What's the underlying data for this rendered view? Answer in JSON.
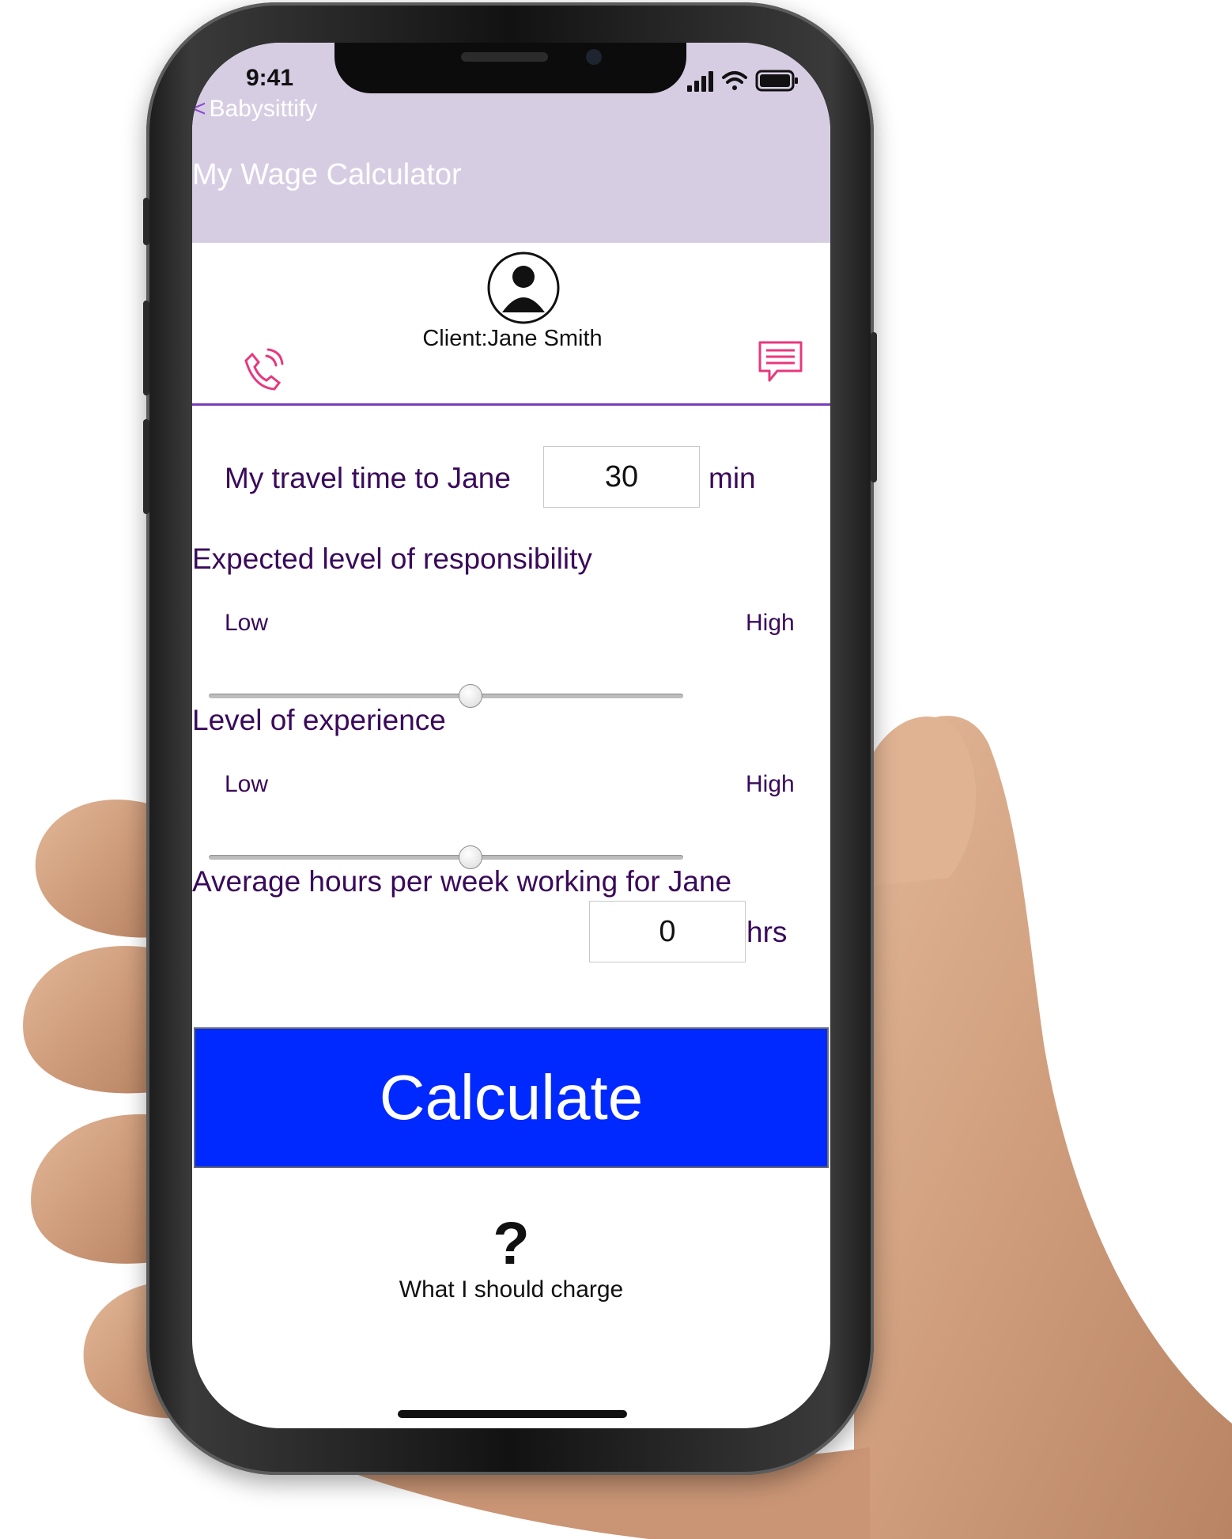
{
  "status_bar": {
    "time": "9:41",
    "icons": [
      "signal-icon",
      "wifi-icon",
      "battery-icon"
    ]
  },
  "nav": {
    "back_chevron": "<",
    "back_label": "Babysittify",
    "title": "My Wage Calculator"
  },
  "client": {
    "name": "Client:Jane Smith",
    "avatar_icon": "user-avatar-icon",
    "call_icon": "phone-icon",
    "message_icon": "chat-icon"
  },
  "form": {
    "travel": {
      "label": "My travel time to Jane",
      "value": "30",
      "unit": "min"
    },
    "responsibility": {
      "label": "Expected level of responsibility",
      "low": "Low",
      "high": "High",
      "level": 0.55
    },
    "experience": {
      "label": "Level of experience",
      "low": "Low",
      "high": "High",
      "level": 0.55
    },
    "hours": {
      "label": "Average hours per week working for Jane",
      "value": "0",
      "unit": "hrs"
    }
  },
  "calculate_label": "Calculate",
  "help": {
    "mark": "?",
    "label": "What I should charge"
  },
  "colors": {
    "header_bg": "#d7cde3",
    "accent_purple": "#7a3db8",
    "label_text": "#3a0a5a",
    "button_blue": "#0029ff",
    "icon_pink": "#e8387e"
  }
}
